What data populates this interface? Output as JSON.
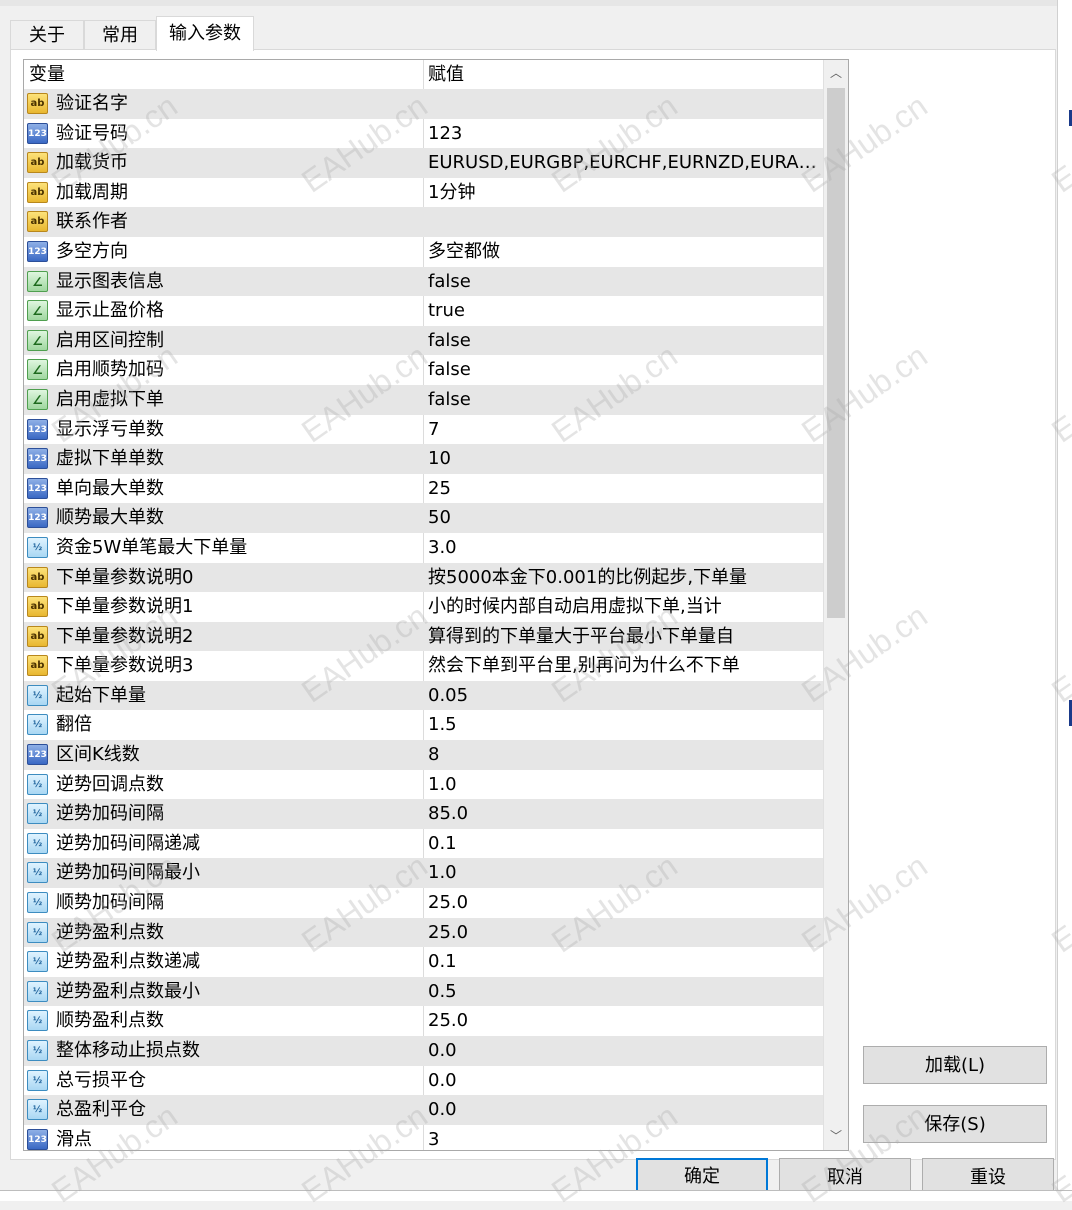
{
  "tabs": [
    {
      "label": "关于"
    },
    {
      "label": "常用"
    },
    {
      "label": "输入参数"
    }
  ],
  "grid": {
    "header": {
      "variable": "变量",
      "value": "赋值"
    },
    "rows": [
      {
        "type": "string",
        "icon": "ab-string-icon",
        "name": "验证名字",
        "value": ""
      },
      {
        "type": "int",
        "icon": "123-int-icon",
        "name": "验证号码",
        "value": "123"
      },
      {
        "type": "string",
        "icon": "ab-string-icon",
        "name": "加载货币",
        "value": "EURUSD,EURGBP,EURCHF,EURNZD,EURAU..."
      },
      {
        "type": "string",
        "icon": "ab-string-icon",
        "name": "加载周期",
        "value": "1分钟"
      },
      {
        "type": "string",
        "icon": "ab-string-icon",
        "name": "联系作者",
        "value": ""
      },
      {
        "type": "int",
        "icon": "123-int-icon",
        "name": "多空方向",
        "value": "多空都做"
      },
      {
        "type": "bool",
        "icon": "bool-icon",
        "name": "显示图表信息",
        "value": "false"
      },
      {
        "type": "bool",
        "icon": "bool-icon",
        "name": "显示止盈价格",
        "value": "true"
      },
      {
        "type": "bool",
        "icon": "bool-icon",
        "name": "启用区间控制",
        "value": "false"
      },
      {
        "type": "bool",
        "icon": "bool-icon",
        "name": "启用顺势加码",
        "value": "false"
      },
      {
        "type": "bool",
        "icon": "bool-icon",
        "name": "启用虚拟下单",
        "value": "false"
      },
      {
        "type": "int",
        "icon": "123-int-icon",
        "name": "显示浮亏单数",
        "value": "7"
      },
      {
        "type": "int",
        "icon": "123-int-icon",
        "name": "虚拟下单单数",
        "value": "10"
      },
      {
        "type": "int",
        "icon": "123-int-icon",
        "name": "单向最大单数",
        "value": "25"
      },
      {
        "type": "int",
        "icon": "123-int-icon",
        "name": "顺势最大单数",
        "value": "50"
      },
      {
        "type": "double",
        "icon": "half-double-icon",
        "name": "资金5W单笔最大下单量",
        "value": "3.0"
      },
      {
        "type": "string",
        "icon": "ab-string-icon",
        "name": "下单量参数说明0",
        "value": "按5000本金下0.001的比例起步,下单量"
      },
      {
        "type": "string",
        "icon": "ab-string-icon",
        "name": "下单量参数说明1",
        "value": "小的时候内部自动启用虚拟下单,当计"
      },
      {
        "type": "string",
        "icon": "ab-string-icon",
        "name": "下单量参数说明2",
        "value": "算得到的下单量大于平台最小下单量自"
      },
      {
        "type": "string",
        "icon": "ab-string-icon",
        "name": "下单量参数说明3",
        "value": "然会下单到平台里,别再问为什么不下单"
      },
      {
        "type": "double",
        "icon": "half-double-icon",
        "name": "起始下单量",
        "value": "0.05"
      },
      {
        "type": "double",
        "icon": "half-double-icon",
        "name": "翻倍",
        "value": "1.5"
      },
      {
        "type": "int",
        "icon": "123-int-icon",
        "name": "区间K线数",
        "value": "8"
      },
      {
        "type": "double",
        "icon": "half-double-icon",
        "name": "逆势回调点数",
        "value": "1.0"
      },
      {
        "type": "double",
        "icon": "half-double-icon",
        "name": "逆势加码间隔",
        "value": "85.0"
      },
      {
        "type": "double",
        "icon": "half-double-icon",
        "name": "逆势加码间隔递减",
        "value": "0.1"
      },
      {
        "type": "double",
        "icon": "half-double-icon",
        "name": "逆势加码间隔最小",
        "value": "1.0"
      },
      {
        "type": "double",
        "icon": "half-double-icon",
        "name": "顺势加码间隔",
        "value": "25.0"
      },
      {
        "type": "double",
        "icon": "half-double-icon",
        "name": "逆势盈利点数",
        "value": "25.0"
      },
      {
        "type": "double",
        "icon": "half-double-icon",
        "name": "逆势盈利点数递减",
        "value": "0.1"
      },
      {
        "type": "double",
        "icon": "half-double-icon",
        "name": "逆势盈利点数最小",
        "value": "0.5"
      },
      {
        "type": "double",
        "icon": "half-double-icon",
        "name": "顺势盈利点数",
        "value": "25.0"
      },
      {
        "type": "double",
        "icon": "half-double-icon",
        "name": "整体移动止损点数",
        "value": "0.0"
      },
      {
        "type": "double",
        "icon": "half-double-icon",
        "name": "总亏损平仓",
        "value": "0.0"
      },
      {
        "type": "double",
        "icon": "half-double-icon",
        "name": "总盈利平仓",
        "value": "0.0"
      },
      {
        "type": "int",
        "icon": "123-int-icon",
        "name": "滑点",
        "value": "3"
      }
    ]
  },
  "icon_glyphs": {
    "string": "ab",
    "int": "123",
    "bool": "∠",
    "double": "½"
  },
  "buttons": {
    "load": "加载(L)",
    "save": "保存(S)",
    "ok": "确定",
    "cancel": "取消",
    "reset": "重设"
  },
  "watermark": "EAHub.cn",
  "colors": {
    "alt_row": "#e6e6e6",
    "focus_border": "#0078d7",
    "button_face": "#e1e1e1"
  }
}
